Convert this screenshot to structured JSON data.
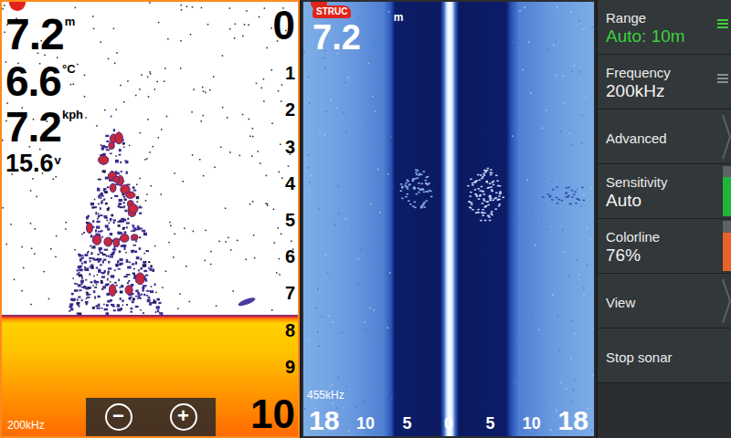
{
  "sonar_panel": {
    "selected": true,
    "depth": "7.2",
    "depth_unit": "m",
    "temperature": "6.6",
    "temperature_unit": "°C",
    "speed": "7.2",
    "speed_unit": "kph",
    "voltage": "15.6",
    "voltage_unit": "v",
    "frequency": "200kHz",
    "scale": [
      "0",
      "1",
      "2",
      "3",
      "4",
      "5",
      "6",
      "7",
      "8",
      "9",
      "10"
    ],
    "zoom_buttons": [
      "−",
      "+"
    ]
  },
  "structure_panel": {
    "selected": false,
    "badge": "STRUC",
    "depth_unit": "m",
    "depth": "7.2",
    "frequency": "455kHz",
    "scale": [
      "18",
      "10",
      "5",
      "0",
      "5",
      "10",
      "18"
    ]
  },
  "menu": [
    {
      "label": "Range",
      "value": "Auto: 10m",
      "kind": "value",
      "highlight": true
    },
    {
      "label": "Frequency",
      "value": "200kHz",
      "kind": "value",
      "highlight": false
    },
    {
      "label": "Advanced",
      "kind": "submenu"
    },
    {
      "label": "Sensitivity",
      "value": "Auto",
      "kind": "slider",
      "level": 0.78,
      "color": "#1fb53a"
    },
    {
      "label": "Colorline",
      "value": "76%",
      "kind": "slider",
      "level": 0.76,
      "color": "#e8622a"
    },
    {
      "label": "View",
      "kind": "submenu"
    },
    {
      "label": "Stop sonar",
      "kind": "action"
    }
  ]
}
